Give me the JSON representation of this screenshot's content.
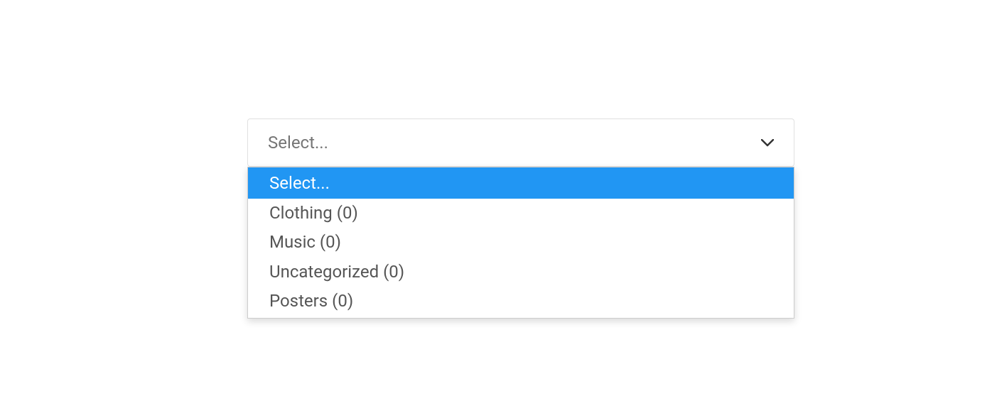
{
  "select": {
    "placeholder": "Select...",
    "options": [
      {
        "label": "Select...",
        "highlighted": true
      },
      {
        "label": "Clothing (0)",
        "highlighted": false
      },
      {
        "label": "Music (0)",
        "highlighted": false
      },
      {
        "label": "Uncategorized (0)",
        "highlighted": false
      },
      {
        "label": "Posters (0)",
        "highlighted": false
      }
    ]
  }
}
